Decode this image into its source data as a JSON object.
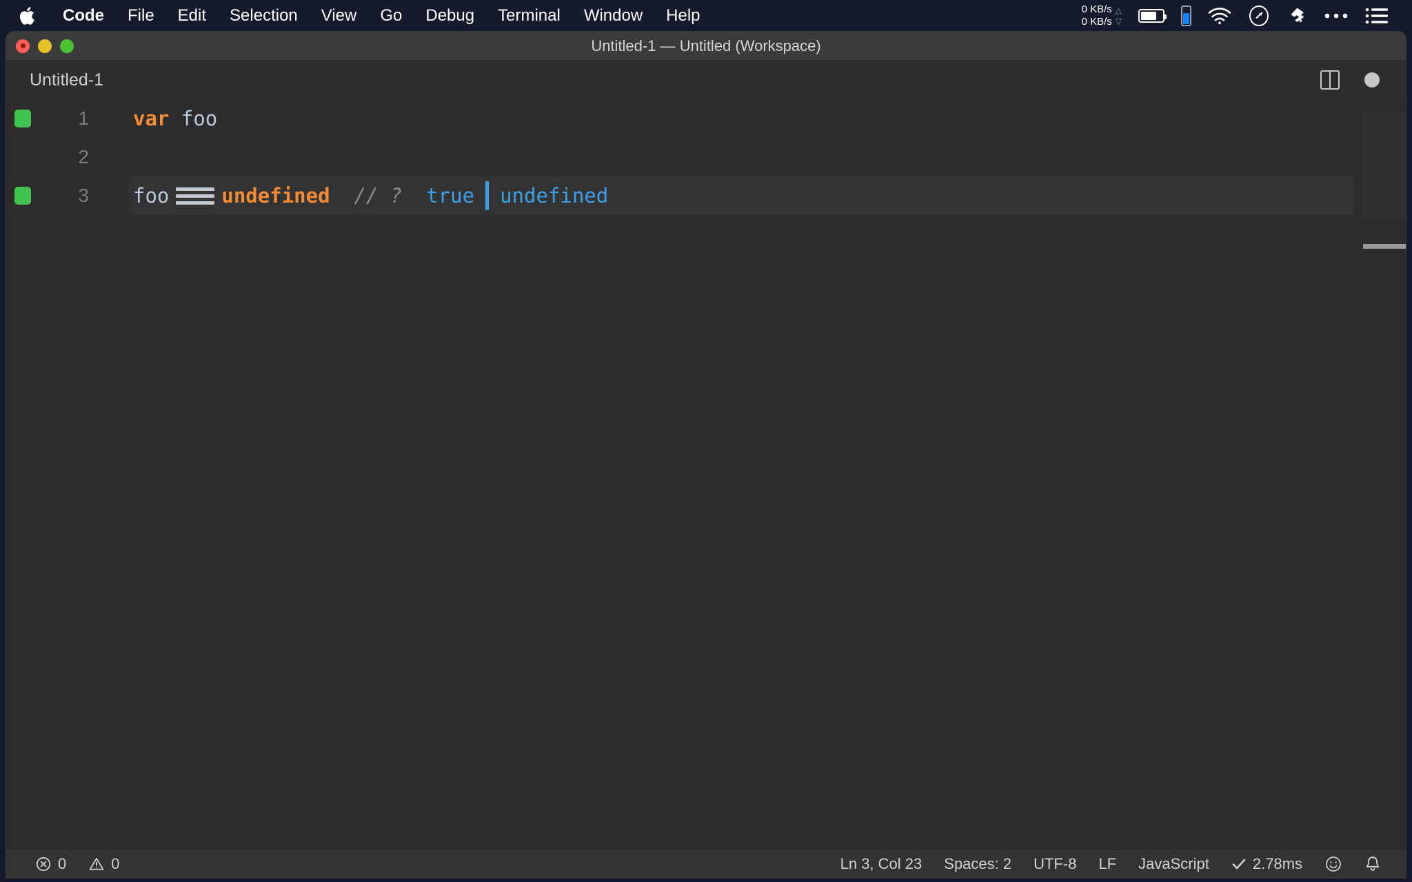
{
  "menubar": {
    "apple_icon": "apple-logo-icon",
    "items": [
      {
        "label": "Code",
        "bold": true
      },
      {
        "label": "File",
        "bold": false
      },
      {
        "label": "Edit",
        "bold": false
      },
      {
        "label": "Selection",
        "bold": false
      },
      {
        "label": "View",
        "bold": false
      },
      {
        "label": "Go",
        "bold": false
      },
      {
        "label": "Debug",
        "bold": false
      },
      {
        "label": "Terminal",
        "bold": false
      },
      {
        "label": "Window",
        "bold": false
      },
      {
        "label": "Help",
        "bold": false
      }
    ],
    "network": {
      "upload": "0 KB/s",
      "download": "0 KB/s",
      "up_arrow": "triangle-up-icon",
      "down_arrow": "triangle-down-icon"
    },
    "status_icons": [
      "battery-icon",
      "battery-vertical-indicator-icon",
      "wifi-icon",
      "compass-icon",
      "dropbox-icon",
      "ellipsis-icon",
      "list-menu-icon"
    ]
  },
  "window": {
    "title": "Untitled-1 — Untitled (Workspace)",
    "traffic_lights": [
      "close",
      "minimize",
      "zoom"
    ]
  },
  "tabbar": {
    "tabs": [
      {
        "label": "Untitled-1",
        "active": true,
        "dirty": true
      }
    ],
    "actions": [
      "split-editor-icon",
      "unsaved-dot-icon"
    ]
  },
  "editor": {
    "language_ligatures": true,
    "lines": [
      {
        "number": "1",
        "git_marker": true,
        "active": false,
        "tokens": [
          {
            "text": "var",
            "type": "keyword"
          },
          {
            "text": " ",
            "type": "plain"
          },
          {
            "text": "foo",
            "type": "variable"
          }
        ]
      },
      {
        "number": "2",
        "git_marker": false,
        "active": false,
        "tokens": []
      },
      {
        "number": "3",
        "git_marker": true,
        "active": true,
        "tokens": [
          {
            "text": "foo",
            "type": "variable"
          },
          {
            "text": " ",
            "type": "plain"
          },
          {
            "text": "===",
            "type": "operator-ligature"
          },
          {
            "text": " ",
            "type": "plain"
          },
          {
            "text": "undefined",
            "type": "keyword"
          },
          {
            "text": " ",
            "type": "plain"
          },
          {
            "text": "// ?",
            "type": "comment"
          },
          {
            "text": " ",
            "type": "plain"
          },
          {
            "text": "true",
            "type": "inline-value"
          },
          {
            "text": "|",
            "type": "cursor"
          },
          {
            "text": "undefined",
            "type": "inline-value"
          }
        ]
      }
    ]
  },
  "statusbar": {
    "left": [
      {
        "icon": "error-icon",
        "label": "0"
      },
      {
        "icon": "warning-icon",
        "label": "0"
      }
    ],
    "right": [
      {
        "icon": null,
        "label": "Ln 3, Col 23"
      },
      {
        "icon": null,
        "label": "Spaces: 2"
      },
      {
        "icon": null,
        "label": "UTF-8"
      },
      {
        "icon": null,
        "label": "LF"
      },
      {
        "icon": null,
        "label": "JavaScript"
      },
      {
        "icon": "check-icon",
        "label": "2.78ms"
      },
      {
        "icon": "smiley-feedback-icon",
        "label": ""
      },
      {
        "icon": "bell-notification-icon",
        "label": ""
      }
    ]
  },
  "colors": {
    "menubar_bg": "#151a2c",
    "titlebar_bg": "#3b3b3b",
    "editor_bg": "#2c2c2c",
    "statusbar_bg": "#333333",
    "accent_orange": "#f28b36",
    "accent_blue": "#3ca0e8",
    "git_added_green": "#41c14d",
    "indicator_blue": "#1a82fb"
  }
}
